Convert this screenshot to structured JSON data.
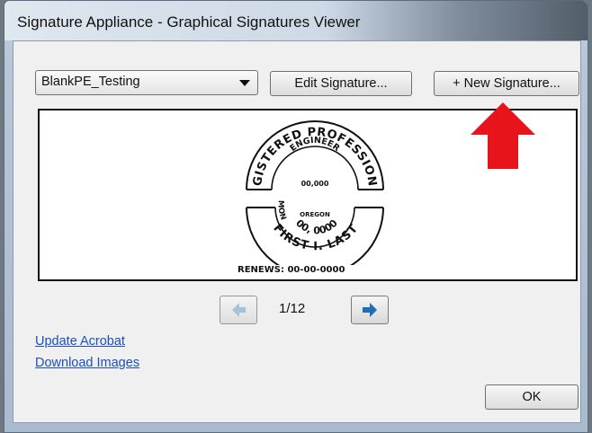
{
  "window": {
    "title": "Signature Appliance - Graphical Signatures Viewer"
  },
  "signature_select": {
    "value": "BlankPE_Testing"
  },
  "toolbar": {
    "edit_label": "Edit Signature...",
    "new_label": "+ New Signature..."
  },
  "stamp": {
    "top_arc": "REGISTERED PROFESSIONAL",
    "inner_arc": "ENGINEER",
    "number": "00,000",
    "state": "OREGON",
    "left_word": "MON",
    "date": "00, 0000",
    "name": "FIRST I. LAST",
    "renews": "RENEWS: 00-00-0000"
  },
  "pager": {
    "label": "1/12",
    "current": 1,
    "total": 12
  },
  "links": {
    "update_acrobat": "Update Acrobat",
    "download_images": "Download Images"
  },
  "footer": {
    "ok_label": "OK"
  },
  "colors": {
    "callout_arrow": "#e8141b",
    "link": "#1d4fbf"
  },
  "icons": {
    "prev": "arrow-left-icon",
    "next": "arrow-right-icon",
    "dropdown": "chevron-down-icon"
  }
}
